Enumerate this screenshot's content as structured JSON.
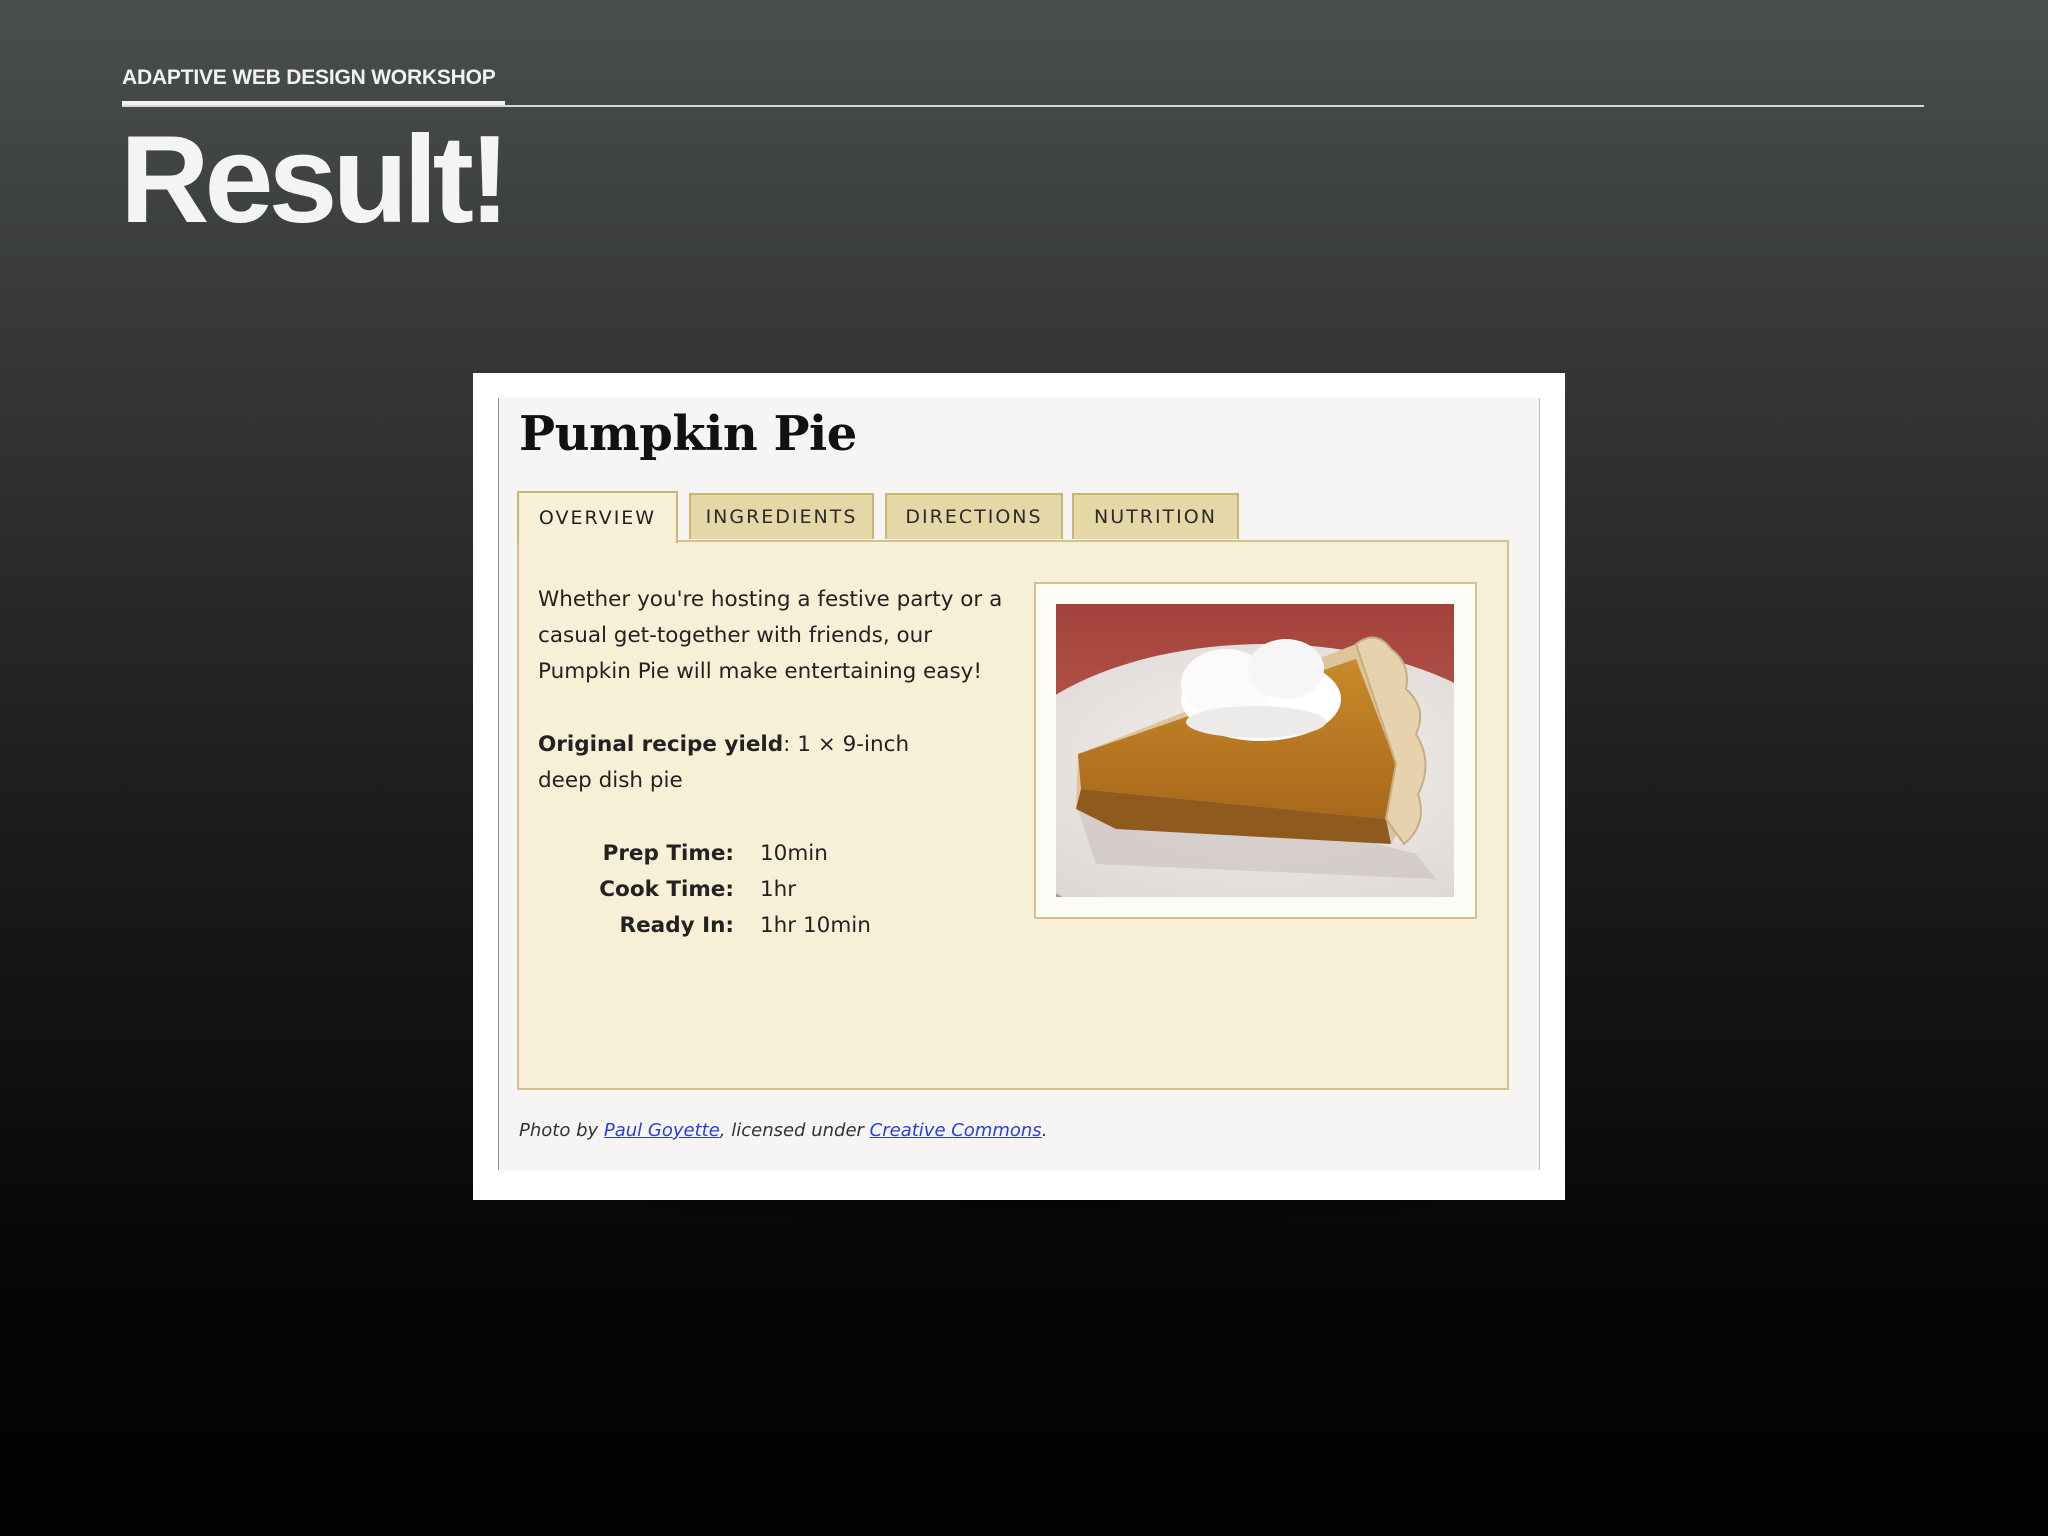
{
  "slide": {
    "kicker": "ADAPTIVE WEB DESIGN WORKSHOP",
    "title": "Result!"
  },
  "recipe": {
    "title": "Pumpkin Pie",
    "tabs": [
      {
        "label": "OVERVIEW",
        "active": true
      },
      {
        "label": "INGREDIENTS",
        "active": false
      },
      {
        "label": "DIRECTIONS",
        "active": false
      },
      {
        "label": "NUTRITION",
        "active": false
      }
    ],
    "description": "Whether you're hosting a festive party or a casual get-together with friends, our Pumpkin Pie will make entertaining easy!",
    "yield_label": "Original recipe yield",
    "yield_value": ": 1 × 9-inch deep dish pie",
    "times": [
      {
        "label": "Prep Time:",
        "value": "10min"
      },
      {
        "label": "Cook Time:",
        "value": "1hr"
      },
      {
        "label": "Ready In:",
        "value": "1hr 10min"
      }
    ],
    "photo_subject": "pumpkin-pie-slice-with-whipped-cream",
    "credit": {
      "prefix": "Photo by ",
      "author": "Paul Goyette",
      "middle": ", licensed under ",
      "license": "Creative Commons",
      "suffix": "."
    }
  },
  "colors": {
    "panel_bg": "#f8efd7",
    "tab_bg": "#e5d7a6",
    "link": "#2a3fd6",
    "slide_text": "#f4f4f4"
  }
}
